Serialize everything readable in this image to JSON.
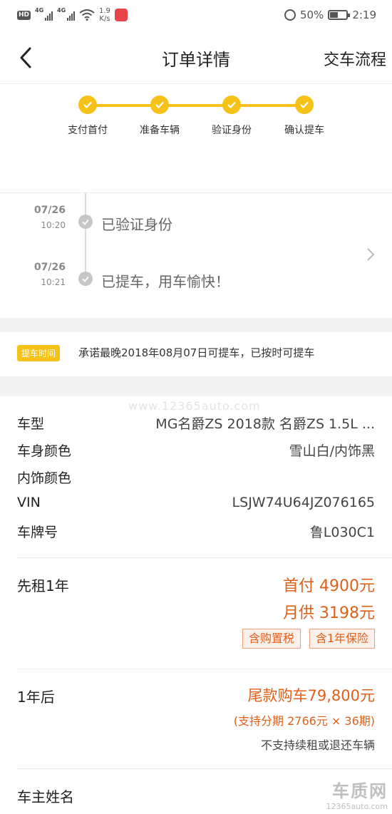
{
  "status_bar": {
    "hd": "HD",
    "net1": "4G",
    "net2": "4G",
    "speed_value": "1.9",
    "speed_unit": "K/s",
    "battery": "50%",
    "battery_level": 0.5,
    "time": "2:19"
  },
  "nav": {
    "title": "订单详情",
    "right_label": "交车流程"
  },
  "progress": {
    "steps": [
      "支付首付",
      "准备车辆",
      "验证身份",
      "确认提车"
    ]
  },
  "timeline": [
    {
      "date": "07/26",
      "time": "10:20",
      "text": "已验证身份"
    },
    {
      "date": "07/26",
      "time": "10:21",
      "text": "已提车，用车愉快！"
    }
  ],
  "pickup": {
    "tag": "提车时间",
    "text": "承诺最晚2018年08月07日可提车，已按时可提车"
  },
  "watermark": "www.12365auto.com",
  "details": [
    {
      "key": "车型",
      "value": "MG名爵ZS 2018款 名爵ZS 1.5L ..."
    },
    {
      "key": "车身颜色",
      "value": "雪山白/内饰黑"
    },
    {
      "key": "内饰颜色",
      "value": ""
    },
    {
      "key": "VIN",
      "value": "LSJW74U64JZ076165"
    },
    {
      "key": "车牌号",
      "value": "鲁L030C1"
    }
  ],
  "plan_first": {
    "title": "先租1年",
    "down_payment": "首付 4900元",
    "monthly": "月供 3198元",
    "tags": [
      "含购置税",
      "含1年保险"
    ]
  },
  "plan_after": {
    "title": "1年后",
    "final": "尾款购车79,800元",
    "installment": "(支持分期 2766元 × 36期)",
    "note": "不支持续租或退还车辆"
  },
  "owner": {
    "label": "车主姓名"
  },
  "corner_logo": {
    "big": "车质网",
    "small": "12365auto.com"
  },
  "colors": {
    "accent_yellow": "#f6c21a",
    "price_orange": "#e0601a"
  }
}
